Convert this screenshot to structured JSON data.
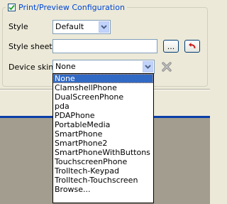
{
  "group": {
    "title": "Print/Preview Configuration",
    "checked": true
  },
  "style": {
    "label": "Style",
    "value": "Default"
  },
  "stylesheet": {
    "label": "Style sheet",
    "value": "",
    "browse_label": "..."
  },
  "device_skin": {
    "label": "Device skin",
    "value": "None",
    "options": [
      "None",
      "ClamshellPhone",
      "DualScreenPhone",
      "pda",
      "PDAPhone",
      "PortableMedia",
      "SmartPhone",
      "SmartPhone2",
      "SmartPhoneWithButtons",
      "TouchscreenPhone",
      "Trolltech-Keypad",
      "Trolltech-Touchscreen",
      "Browse..."
    ],
    "selected_index": 0
  },
  "icons": {
    "checkbox": "check-icon",
    "dropdown": "chevron-down-icon",
    "reset": "undo-arrow-icon",
    "remove": "x-icon"
  },
  "colors": {
    "title_blue": "#0046d5",
    "selection": "#316ac5",
    "reset_red": "#c8201e"
  }
}
